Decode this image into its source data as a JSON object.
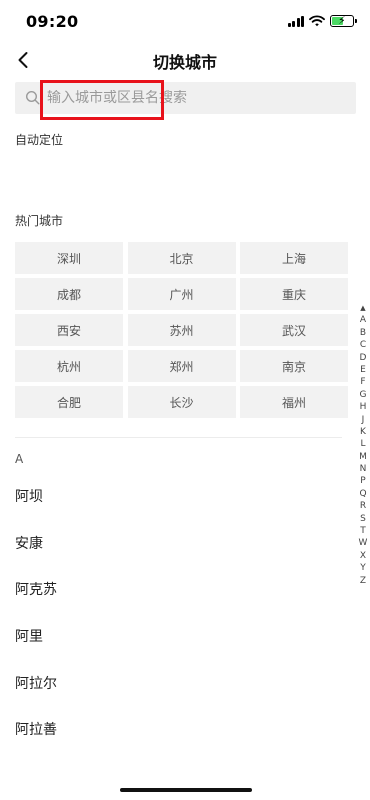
{
  "status": {
    "time": "09:20"
  },
  "nav": {
    "title": "切换城市"
  },
  "search": {
    "placeholder": "输入城市或区县名搜索"
  },
  "sections": {
    "auto_locate": "自动定位",
    "hot_cities": "热门城市",
    "letter_a": "A"
  },
  "hot_cities": [
    "深圳",
    "北京",
    "上海",
    "成都",
    "广州",
    "重庆",
    "西安",
    "苏州",
    "武汉",
    "杭州",
    "郑州",
    "南京",
    "合肥",
    "长沙",
    "福州"
  ],
  "city_list": [
    "阿坝",
    "安康",
    "阿克苏",
    "阿里",
    "阿拉尔",
    "阿拉善"
  ],
  "alphabet_index": {
    "top_symbol": "▲",
    "letters": [
      "A",
      "B",
      "C",
      "D",
      "E",
      "F",
      "G",
      "H",
      "J",
      "K",
      "L",
      "M",
      "N",
      "P",
      "Q",
      "R",
      "S",
      "T",
      "W",
      "X",
      "Y",
      "Z"
    ]
  },
  "icons": {
    "back": "chevron-left-icon",
    "search": "search-icon",
    "signal": "signal-icon",
    "wifi": "wifi-icon",
    "battery": "battery-charging-icon"
  },
  "colors": {
    "highlight": "#e8121b",
    "battery": "#4cd964"
  }
}
